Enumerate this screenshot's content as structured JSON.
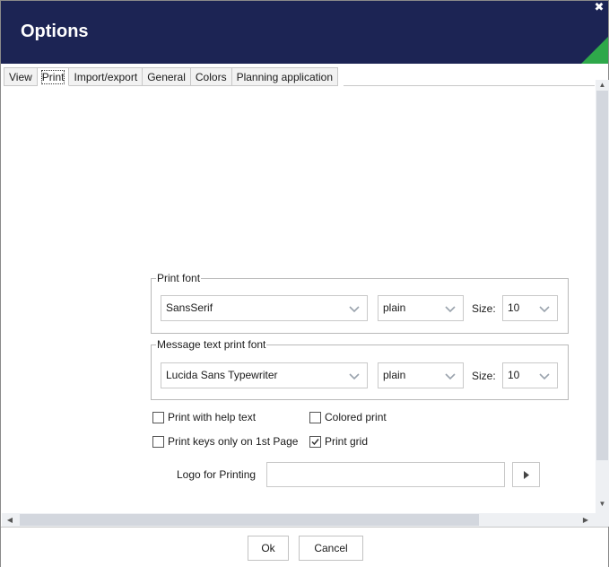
{
  "window": {
    "title": "Options",
    "close_glyph": "✖"
  },
  "colors": {
    "titlebar": "#1c2454",
    "accent": "#2ea84a"
  },
  "tabs": [
    {
      "label": "View"
    },
    {
      "label": "Print",
      "active": true
    },
    {
      "label": "Import/export"
    },
    {
      "label": "General"
    },
    {
      "label": "Colors"
    },
    {
      "label": "Planning application"
    }
  ],
  "print_font": {
    "legend": "Print font",
    "family": "SansSerif",
    "style": "plain",
    "size_label": "Size:",
    "size": "10"
  },
  "message_font": {
    "legend": "Message text print font",
    "family": "Lucida Sans Typewriter",
    "style": "plain",
    "size_label": "Size:",
    "size": "10"
  },
  "options": {
    "print_help_text": {
      "label": "Print with help text",
      "checked": false
    },
    "colored_print": {
      "label": "Colored print",
      "checked": false
    },
    "print_keys_first_page": {
      "label": "Print keys only on 1st Page",
      "checked": false
    },
    "print_grid": {
      "label": "Print grid",
      "checked": true
    }
  },
  "logo": {
    "label": "Logo for Printing",
    "value": ""
  },
  "footer": {
    "ok_label": "Ok",
    "cancel_label": "Cancel"
  }
}
